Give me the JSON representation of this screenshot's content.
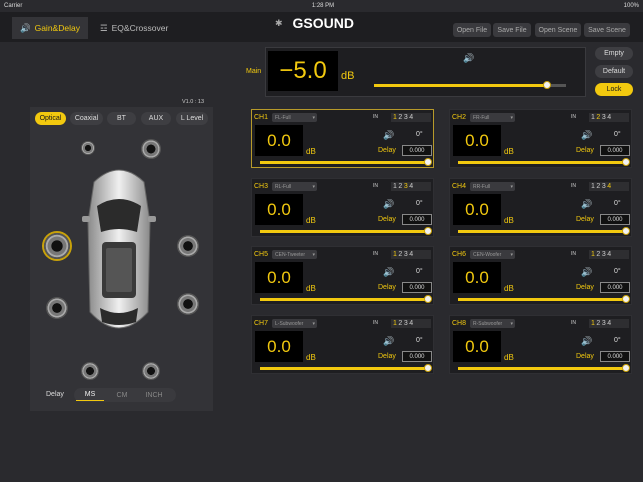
{
  "status": {
    "carrier": "Carrier",
    "time": "1:28 PM",
    "battery": "100%"
  },
  "tabs": [
    {
      "label": "Gain&Delay",
      "active": true,
      "icon": "speaker-icon"
    },
    {
      "label": "EQ&Crossover",
      "active": false,
      "icon": "sliders-icon"
    }
  ],
  "brand": "GSOUND",
  "top_buttons": [
    "Open File",
    "Save File",
    "Open Scene",
    "Save Scene"
  ],
  "version": "V1.0 : 13",
  "sources": [
    {
      "label": "Optical",
      "selected": true
    },
    {
      "label": "Coaxial",
      "selected": false
    },
    {
      "label": "BT",
      "selected": false
    },
    {
      "label": "AUX",
      "selected": false
    },
    {
      "label": "L Level",
      "selected": false
    }
  ],
  "delay_label": "Delay",
  "units": [
    {
      "label": "MS",
      "selected": true
    },
    {
      "label": "CM",
      "selected": false
    },
    {
      "label": "INCH",
      "selected": false
    }
  ],
  "main": {
    "label": "Main",
    "value": "−5.0",
    "unit": "dB",
    "level": 0.9
  },
  "right_buttons": [
    "Empty",
    "Default",
    "Lock"
  ],
  "channels": [
    {
      "name": "CH1",
      "route": "FL-Full",
      "in_label": "IN",
      "inputs": [
        "1",
        "2",
        "3",
        "4"
      ],
      "active_input": 0,
      "value": "0.0",
      "unit": "dB",
      "delay_label": "Delay",
      "delay": "0.000",
      "phase": "0°",
      "level": 1.0,
      "selected": true
    },
    {
      "name": "CH2",
      "route": "FR-Full",
      "in_label": "IN",
      "inputs": [
        "1",
        "2",
        "3",
        "4"
      ],
      "active_input": 1,
      "value": "0.0",
      "unit": "dB",
      "delay_label": "Delay",
      "delay": "0.000",
      "phase": "0°",
      "level": 1.0,
      "selected": false
    },
    {
      "name": "CH3",
      "route": "RL-Full",
      "in_label": "IN",
      "inputs": [
        "1",
        "2",
        "3",
        "4"
      ],
      "active_input": 2,
      "value": "0.0",
      "unit": "dB",
      "delay_label": "Delay",
      "delay": "0.000",
      "phase": "0°",
      "level": 1.0,
      "selected": false
    },
    {
      "name": "CH4",
      "route": "RR-Full",
      "in_label": "IN",
      "inputs": [
        "1",
        "2",
        "3",
        "4"
      ],
      "active_input": 3,
      "value": "0.0",
      "unit": "dB",
      "delay_label": "Delay",
      "delay": "0.000",
      "phase": "0°",
      "level": 1.0,
      "selected": false
    },
    {
      "name": "CH5",
      "route": "CEN-Tweeter",
      "in_label": "IN",
      "inputs": [
        "1",
        "2",
        "3",
        "4"
      ],
      "active_input": 0,
      "value": "0.0",
      "unit": "dB",
      "delay_label": "Delay",
      "delay": "0.000",
      "phase": "0°",
      "level": 1.0,
      "selected": false
    },
    {
      "name": "CH6",
      "route": "CEN-Woofer",
      "in_label": "IN",
      "inputs": [
        "1",
        "2",
        "3",
        "4"
      ],
      "active_input": 0,
      "value": "0.0",
      "unit": "dB",
      "delay_label": "Delay",
      "delay": "0.000",
      "phase": "0°",
      "level": 1.0,
      "selected": false
    },
    {
      "name": "CH7",
      "route": "L-Subwoofer",
      "in_label": "IN",
      "inputs": [
        "1",
        "2",
        "3",
        "4"
      ],
      "active_input": 0,
      "value": "0.0",
      "unit": "dB",
      "delay_label": "Delay",
      "delay": "0.000",
      "phase": "0°",
      "level": 1.0,
      "selected": false
    },
    {
      "name": "CH8",
      "route": "R-Subwoofer",
      "in_label": "IN",
      "inputs": [
        "1",
        "2",
        "3",
        "4"
      ],
      "active_input": 0,
      "value": "0.0",
      "unit": "dB",
      "delay_label": "Delay",
      "delay": "0.000",
      "phase": "0°",
      "level": 1.0,
      "selected": false
    }
  ],
  "colors": {
    "accent": "#f2c90f",
    "background": "#2a2a2e",
    "panel": "#1e1e21"
  }
}
